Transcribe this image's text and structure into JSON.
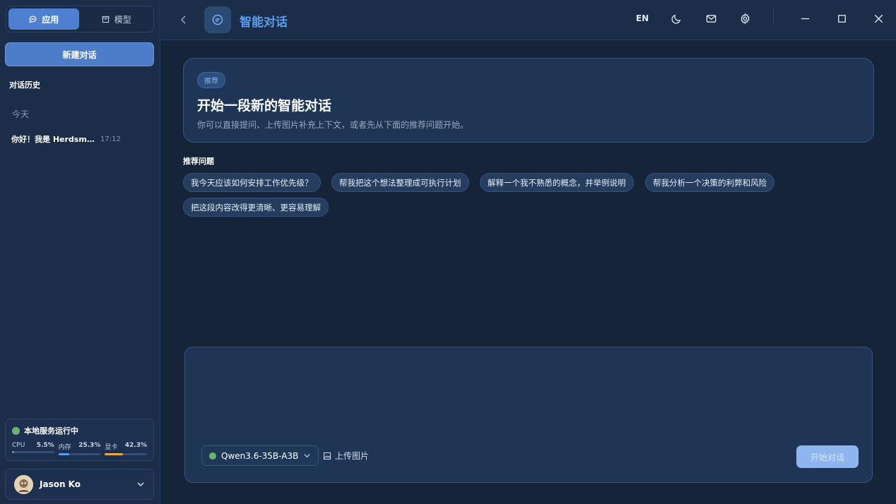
{
  "sidebar": {
    "tabs": [
      {
        "label": "应用",
        "icon": "chat-bubble-icon",
        "active": true
      },
      {
        "label": "模型",
        "icon": "box-icon",
        "active": false
      }
    ],
    "new_chat_label": "新建对话",
    "history_title": "对话历史",
    "history_group": "今天",
    "history_items": [
      {
        "title": "你好！我是 Herdsm...",
        "time": "17:12"
      }
    ],
    "status": {
      "label": "本地服务运行中",
      "metrics": [
        {
          "name": "CPU",
          "value": "5.5%",
          "percent": 5.5,
          "color": "#6bb36f"
        },
        {
          "name": "内存",
          "value": "25.3%",
          "percent": 25.3,
          "color": "#5b9cf0"
        },
        {
          "name": "显卡",
          "value": "42.3%",
          "percent": 42.3,
          "color": "#e9a64b"
        }
      ]
    },
    "user": {
      "name": "Jason Ko"
    }
  },
  "topbar": {
    "title": "智能对话",
    "lang_label": "EN"
  },
  "hero": {
    "tag": "推荐",
    "heading": "开始一段新的智能对话",
    "subtitle": "你可以直接提问、上传图片补充上下文，或者先从下面的推荐问题开始。"
  },
  "suggestions": {
    "title": "推荐问题",
    "items": [
      "我今天应该如何安排工作优先级？",
      "帮我把这个想法整理成可执行计划",
      "解释一个我不熟悉的概念，并举例说明",
      "帮我分析一个决策的利弊和风险",
      "把这段内容改得更清晰、更容易理解"
    ]
  },
  "composer": {
    "input_value": "",
    "input_placeholder": "",
    "model": "Qwen3.6-35B-A3B",
    "upload_label": "上传图片",
    "send_label": "开始对话"
  }
}
